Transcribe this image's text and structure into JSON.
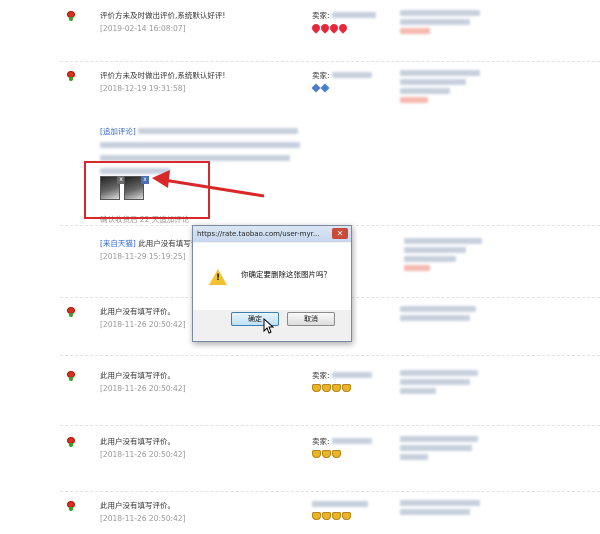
{
  "reviews": [
    {
      "comment": "评价方未及时做出评价,系统默认好评!",
      "date": "[2019-02-14 16:08:07]",
      "seller_label": "卖家:",
      "badge": "heart"
    },
    {
      "comment": "评价方未及时做出评价,系统默认好评!",
      "date": "[2018-12-19 19:31:58]",
      "seller_label": "卖家:",
      "badge": "diamond",
      "appended_tag": "[追加评论]",
      "confirm_note": "确认收货后 22 天追加评论"
    },
    {
      "source_tag": "[来自天猫]",
      "comment": "此用户没有填写评",
      "date": "[2018-11-29 15:19:25]"
    },
    {
      "comment": "此用户没有填写评价。",
      "date": "[2018-11-26 20:50:42]"
    },
    {
      "comment": "此用户没有填写评价。",
      "date": "[2018-11-26 20:50:42]",
      "seller_label": "卖家:",
      "badge": "crown"
    },
    {
      "comment": "此用户没有填写评价。",
      "date": "[2018-11-26 20:50:42]",
      "seller_label": "卖家:",
      "badge": "crown"
    },
    {
      "comment": "此用户没有填写评价。",
      "date": "[2018-11-26 20:50:42]",
      "badge": "crown"
    }
  ],
  "dialog": {
    "title": "https://rate.taobao.com/user-myr...",
    "close_label": "✕",
    "message": "你确定要删除这张图片吗？",
    "ok_label": "确定",
    "cancel_label": "取消"
  },
  "thumb_delete_label": "x",
  "colors": {
    "highlight": "#d8282a",
    "link": "#3366cc"
  }
}
